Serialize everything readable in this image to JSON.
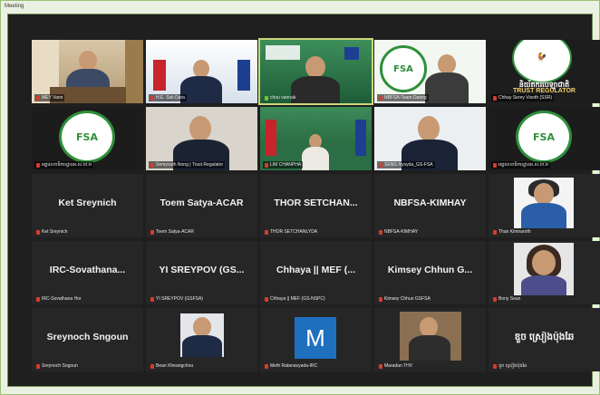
{
  "window": {
    "title": "Meeting"
  },
  "tiles": [
    {
      "label": "MEY Vann",
      "big": ""
    },
    {
      "label": "H.E. Sok Dara",
      "big": ""
    },
    {
      "label": "chou vannak",
      "big": ""
    },
    {
      "label": "NBFSA-Team Daeng",
      "big": ""
    },
    {
      "label": "Chhay Serey Visoth (SSR)",
      "big": ""
    },
    {
      "label": "អគ្គលេខាធិការដ្ឋានអ.ស.ហ.ម",
      "big": ""
    },
    {
      "label": "Sereyvuth Nong | Trust Regulator",
      "big": ""
    },
    {
      "label": "LIM CHANPHA",
      "big": ""
    },
    {
      "label": "SENG Nyvyda_GS-FSA",
      "big": ""
    },
    {
      "label": "អគ្គលេខាធិការដ្ឋានអ.ស.ហ.ម",
      "big": ""
    },
    {
      "label": "Ket Sreynich",
      "big": "Ket Sreynich"
    },
    {
      "label": "Toem Satya-ACAR",
      "big": "Toem Satya-ACAR"
    },
    {
      "label": "THOR SETCHANLYDA",
      "big": "THOR  SETCHAN..."
    },
    {
      "label": "NBFSA-KIMHAY",
      "big": "NBFSA-KIMHAY"
    },
    {
      "label": "Than Kimnaroth",
      "big": ""
    },
    {
      "label": "IRC-Sovathana Hor",
      "big": "IRC-Sovathana..."
    },
    {
      "label": "YI SREYPOV (GSFSA)",
      "big": "YI SREYPOV (GS..."
    },
    {
      "label": "Chhaya || MEF (GS-NSPC)",
      "big": "Chhaya || MEF (..."
    },
    {
      "label": "Kimsey Chhun GSFSA",
      "big": "Kimsey Chhun G..."
    },
    {
      "label": "Bony Sean",
      "big": ""
    },
    {
      "label": "Sreynoch Sngoun",
      "big": "Sreynoch Sngoun"
    },
    {
      "label": "Bean Kheangchou",
      "big": ""
    },
    {
      "label": "Meth Ratanavyada-IRC",
      "big": ""
    },
    {
      "label": "Maradan THV",
      "big": ""
    },
    {
      "label": "ឌួច ស្រៀងប៉ុងឆៃ",
      "big": "ឌួច ស្រៀងប៉ុងឆៃ"
    }
  ],
  "branding": {
    "khmer_name": "និយ័តករបេឡាជាតិ",
    "latin_name": "TRUST REGULATOR",
    "fsa_text": "FSA",
    "m_letter": "M"
  },
  "colors": {
    "accent_green": "#2f8f3a",
    "tile_bg": "#262626",
    "stage_bg": "#1f1f1f",
    "mic_red": "#d93b2b"
  }
}
